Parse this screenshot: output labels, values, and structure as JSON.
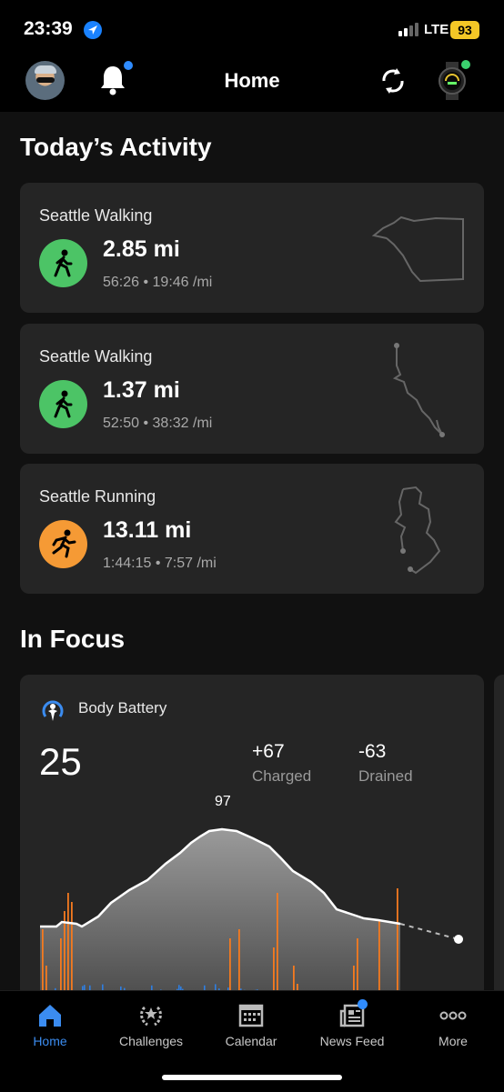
{
  "status_bar": {
    "time": "23:39",
    "network": "LTE",
    "battery": "93"
  },
  "header": {
    "title": "Home"
  },
  "today": {
    "heading": "Today’s Activity",
    "activities": [
      {
        "name": "Seattle Walking",
        "distance": "2.85 mi",
        "details": "56:26 • 19:46 /mi",
        "type": "walking",
        "color": "#4cc466"
      },
      {
        "name": "Seattle Walking",
        "distance": "1.37 mi",
        "details": "52:50 • 38:32 /mi",
        "type": "walking",
        "color": "#4cc466"
      },
      {
        "name": "Seattle Running",
        "distance": "13.11 mi",
        "details": "1:44:15 • 7:57 /mi",
        "type": "running",
        "color": "#f59a35"
      }
    ]
  },
  "focus": {
    "heading": "In Focus",
    "body_battery": {
      "title": "Body Battery",
      "current": "25",
      "charged_value": "+67",
      "charged_label": "Charged",
      "drained_value": "-63",
      "drained_label": "Drained",
      "peak_label": "97"
    }
  },
  "tabs": [
    {
      "label": "Home",
      "icon": "home-icon",
      "active": true
    },
    {
      "label": "Challenges",
      "icon": "laurel-icon"
    },
    {
      "label": "Calendar",
      "icon": "calendar-icon"
    },
    {
      "label": "News Feed",
      "icon": "news-feed-icon"
    },
    {
      "label": "More",
      "icon": "more-icon"
    }
  ],
  "colors": {
    "walking": "#4cc466",
    "running": "#f59a35",
    "accent": "#3b8cf0",
    "stress": "#2f7ee0",
    "activity": "#f47a1f"
  }
}
